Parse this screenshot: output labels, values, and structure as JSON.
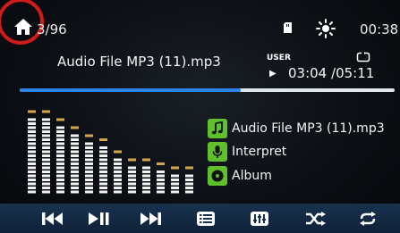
{
  "status_bar": {
    "track_count": "3/96",
    "clock": "00:38",
    "icons": [
      "home-icon",
      "sd-card-icon",
      "brightness-icon"
    ]
  },
  "now_playing": {
    "title": "Audio File MP3 (11).mp3",
    "eq_preset": "USER",
    "play_state": "▶",
    "elapsed": "03:04",
    "total": "/05:11",
    "progress_fraction": 0.59
  },
  "metadata": {
    "title": "Audio File MP3 (11).mp3",
    "artist": "Interpret",
    "album": "Album",
    "icons": [
      "music-note-icon",
      "microphone-icon",
      "album-disc-icon"
    ]
  },
  "spectrum_levels": [
    1.0,
    1.0,
    0.89,
    0.79,
    0.7,
    0.63,
    0.47,
    0.36,
    0.36,
    0.29,
    0.26,
    0.26
  ],
  "controls": [
    "previous-icon",
    "play-pause-icon",
    "next-icon",
    "playlist-icon",
    "equalizer-icon",
    "shuffle-icon",
    "repeat-icon"
  ],
  "colors": {
    "accent_blue": "#2d83e6",
    "meta_icon_green": "#5fbf2c",
    "peak_marker": "#d9a34a",
    "highlight_ring": "#d11a1a",
    "control_bar": "#15304c"
  }
}
